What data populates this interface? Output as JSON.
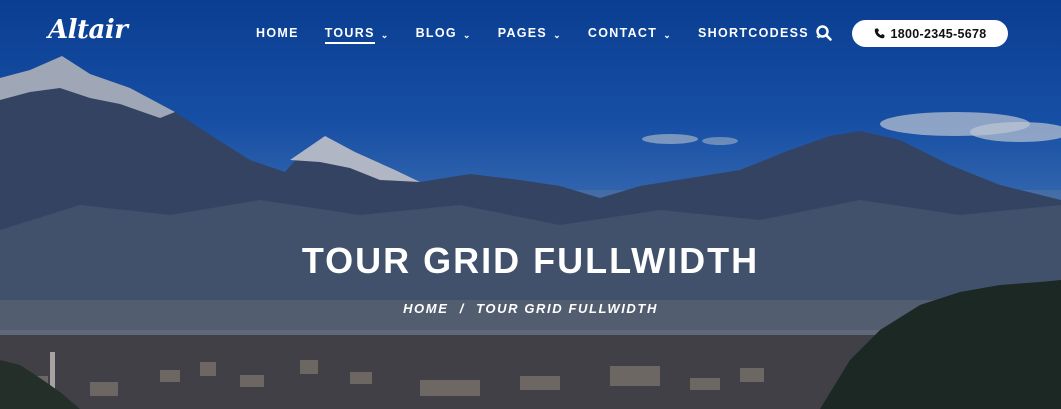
{
  "header": {
    "logo": "Altair",
    "nav": [
      {
        "label": "HOME",
        "has_dropdown": false,
        "active": false
      },
      {
        "label": "TOURS",
        "has_dropdown": true,
        "active": true
      },
      {
        "label": "BLOG",
        "has_dropdown": true,
        "active": false
      },
      {
        "label": "PAGES",
        "has_dropdown": true,
        "active": false
      },
      {
        "label": "CONTACT",
        "has_dropdown": true,
        "active": false
      },
      {
        "label": "SHORTCODESS",
        "has_dropdown": true,
        "active": false
      }
    ],
    "search_icon": "search-icon",
    "phone": {
      "icon": "phone-icon",
      "label": "1800-2345-5678"
    }
  },
  "hero": {
    "title": "TOUR GRID FULLWIDTH",
    "breadcrumb": {
      "home": "HOME",
      "separator": "/",
      "current": "TOUR GRID FULLWIDTH"
    }
  },
  "colors": {
    "sky_top": "#0a47a8",
    "text": "#ffffff",
    "phone_button_bg": "#ffffff",
    "phone_button_text": "#111111"
  }
}
